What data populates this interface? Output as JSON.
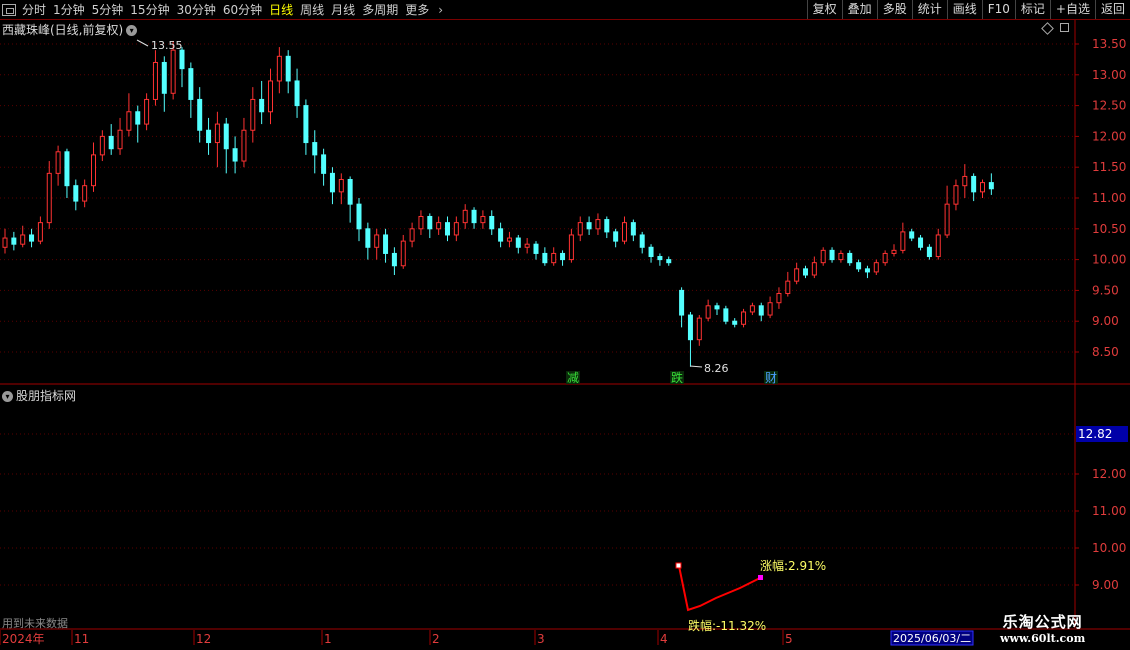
{
  "toolbar": {
    "periods": [
      "分时",
      "1分钟",
      "5分钟",
      "15分钟",
      "30分钟",
      "60分钟",
      "日线",
      "周线",
      "月线",
      "多周期",
      "更多"
    ],
    "active_period": "日线",
    "right_buttons": [
      "复权",
      "叠加",
      "多股",
      "统计",
      "画线",
      "F10",
      "标记",
      "+自选",
      "返回"
    ]
  },
  "main_chart": {
    "title": "西藏珠峰(日线,前复权)",
    "high_label": "13.55",
    "low_label": "8.26",
    "y_ticks": [
      "13.50",
      "13.00",
      "12.50",
      "12.00",
      "11.50",
      "11.00",
      "10.50",
      "10.00",
      "9.50",
      "9.00",
      "8.50"
    ],
    "markers": [
      {
        "text": "减",
        "color": "#38e038"
      },
      {
        "text": "跌",
        "color": "#38e038"
      },
      {
        "text": "财",
        "color": "#4aa0ff"
      }
    ]
  },
  "indicator": {
    "title": "股朋指标网",
    "current_value": "12.82",
    "y_ticks": [
      "12.00",
      "11.00",
      "10.00",
      "9.00"
    ],
    "rise_label": "涨幅:2.91%",
    "fall_label": "跌幅:-11.32%",
    "future_note": "用到未来数据"
  },
  "timeline": {
    "labels": [
      "2024年",
      "11",
      "12",
      "1",
      "2",
      "3",
      "4",
      "5"
    ],
    "current_date": "2025/06/03/二"
  },
  "watermark": {
    "line1": "乐淘公式网",
    "line2": "www.60lt.com"
  },
  "colors": {
    "up": "#ff3232",
    "down": "#54ffff",
    "grid": "#800000",
    "active": "#ffff00",
    "line": "#ff0000"
  },
  "icons": [
    "window-icon",
    "chevron-down-icon",
    "diamond-icon",
    "square-icon",
    "chevron-right-icon"
  ],
  "chart_data": {
    "type": "candlestick",
    "title": "西藏珠峰(日线,前复权)",
    "ylim": [
      8.0,
      13.8
    ],
    "x_ticks": [
      "2024年",
      "11",
      "12",
      "1",
      "2",
      "3",
      "4",
      "5"
    ],
    "candles": [
      [
        10.2,
        10.35,
        10.5,
        10.1
      ],
      [
        10.35,
        10.25,
        10.45,
        10.15
      ],
      [
        10.25,
        10.4,
        10.55,
        10.2
      ],
      [
        10.4,
        10.3,
        10.5,
        10.2
      ],
      [
        10.3,
        10.6,
        10.7,
        10.25
      ],
      [
        10.6,
        11.4,
        11.6,
        10.5
      ],
      [
        11.4,
        11.75,
        11.85,
        11.2
      ],
      [
        11.75,
        11.2,
        11.8,
        11.0
      ],
      [
        11.2,
        10.95,
        11.3,
        10.8
      ],
      [
        10.95,
        11.2,
        11.3,
        10.85
      ],
      [
        11.2,
        11.7,
        11.9,
        11.1
      ],
      [
        11.7,
        12.0,
        12.1,
        11.6
      ],
      [
        12.0,
        11.8,
        12.2,
        11.7
      ],
      [
        11.8,
        12.1,
        12.3,
        11.7
      ],
      [
        12.1,
        12.4,
        12.7,
        12.0
      ],
      [
        12.4,
        12.2,
        12.5,
        11.9
      ],
      [
        12.2,
        12.6,
        12.7,
        12.1
      ],
      [
        12.6,
        13.2,
        13.4,
        12.5
      ],
      [
        13.2,
        12.7,
        13.3,
        12.4
      ],
      [
        12.7,
        13.4,
        13.55,
        12.6
      ],
      [
        13.4,
        13.1,
        13.45,
        12.8
      ],
      [
        13.1,
        12.6,
        13.2,
        12.3
      ],
      [
        12.6,
        12.1,
        12.8,
        11.9
      ],
      [
        12.1,
        11.9,
        12.3,
        11.7
      ],
      [
        11.9,
        12.2,
        12.4,
        11.5
      ],
      [
        12.2,
        11.8,
        12.3,
        11.4
      ],
      [
        11.8,
        11.6,
        12.0,
        11.4
      ],
      [
        11.6,
        12.1,
        12.3,
        11.5
      ],
      [
        12.1,
        12.6,
        12.8,
        11.9
      ],
      [
        12.6,
        12.4,
        12.9,
        12.2
      ],
      [
        12.4,
        12.9,
        13.1,
        12.2
      ],
      [
        12.9,
        13.3,
        13.45,
        12.7
      ],
      [
        13.3,
        12.9,
        13.4,
        12.7
      ],
      [
        12.9,
        12.5,
        13.1,
        12.3
      ],
      [
        12.5,
        11.9,
        12.6,
        11.7
      ],
      [
        11.9,
        11.7,
        12.1,
        11.4
      ],
      [
        11.7,
        11.4,
        11.8,
        11.2
      ],
      [
        11.4,
        11.1,
        11.5,
        10.9
      ],
      [
        11.1,
        11.3,
        11.4,
        10.9
      ],
      [
        11.3,
        10.9,
        11.35,
        10.6
      ],
      [
        10.9,
        10.5,
        11.0,
        10.3
      ],
      [
        10.5,
        10.2,
        10.6,
        10.0
      ],
      [
        10.2,
        10.4,
        10.5,
        10.0
      ],
      [
        10.4,
        10.1,
        10.5,
        9.95
      ],
      [
        10.1,
        9.9,
        10.2,
        9.75
      ],
      [
        9.9,
        10.3,
        10.4,
        9.85
      ],
      [
        10.3,
        10.5,
        10.6,
        10.2
      ],
      [
        10.5,
        10.7,
        10.8,
        10.4
      ],
      [
        10.7,
        10.5,
        10.75,
        10.35
      ],
      [
        10.5,
        10.6,
        10.7,
        10.4
      ],
      [
        10.6,
        10.4,
        10.7,
        10.3
      ],
      [
        10.4,
        10.6,
        10.7,
        10.3
      ],
      [
        10.6,
        10.8,
        10.9,
        10.5
      ],
      [
        10.8,
        10.6,
        10.85,
        10.5
      ],
      [
        10.6,
        10.7,
        10.8,
        10.5
      ],
      [
        10.7,
        10.5,
        10.8,
        10.4
      ],
      [
        10.5,
        10.3,
        10.6,
        10.2
      ],
      [
        10.3,
        10.35,
        10.45,
        10.2
      ],
      [
        10.35,
        10.2,
        10.4,
        10.1
      ],
      [
        10.2,
        10.25,
        10.35,
        10.1
      ],
      [
        10.25,
        10.1,
        10.3,
        10.0
      ],
      [
        10.1,
        9.95,
        10.2,
        9.9
      ],
      [
        9.95,
        10.1,
        10.2,
        9.9
      ],
      [
        10.1,
        10.0,
        10.15,
        9.9
      ],
      [
        10.0,
        10.4,
        10.5,
        9.95
      ],
      [
        10.4,
        10.6,
        10.7,
        10.3
      ],
      [
        10.6,
        10.5,
        10.7,
        10.4
      ],
      [
        10.5,
        10.65,
        10.75,
        10.4
      ],
      [
        10.65,
        10.45,
        10.7,
        10.35
      ],
      [
        10.45,
        10.3,
        10.5,
        10.2
      ],
      [
        10.3,
        10.6,
        10.7,
        10.25
      ],
      [
        10.6,
        10.4,
        10.65,
        10.3
      ],
      [
        10.4,
        10.2,
        10.45,
        10.1
      ],
      [
        10.2,
        10.05,
        10.25,
        9.95
      ],
      [
        10.05,
        10.0,
        10.1,
        9.9
      ],
      [
        10.0,
        9.95,
        10.05,
        9.9
      ],
      [
        9.5,
        9.1,
        9.55,
        8.9
      ],
      [
        9.1,
        8.7,
        9.15,
        8.26
      ],
      [
        8.7,
        9.05,
        9.1,
        8.6
      ],
      [
        9.05,
        9.25,
        9.35,
        9.0
      ],
      [
        9.25,
        9.2,
        9.3,
        9.1
      ],
      [
        9.2,
        9.0,
        9.25,
        8.95
      ],
      [
        9.0,
        8.95,
        9.05,
        8.9
      ],
      [
        8.95,
        9.15,
        9.2,
        8.9
      ],
      [
        9.15,
        9.25,
        9.3,
        9.1
      ],
      [
        9.25,
        9.1,
        9.3,
        9.0
      ],
      [
        9.1,
        9.3,
        9.4,
        9.05
      ],
      [
        9.3,
        9.45,
        9.55,
        9.2
      ],
      [
        9.45,
        9.65,
        9.8,
        9.4
      ],
      [
        9.65,
        9.85,
        9.95,
        9.6
      ],
      [
        9.85,
        9.75,
        9.9,
        9.7
      ],
      [
        9.75,
        9.95,
        10.05,
        9.7
      ],
      [
        9.95,
        10.15,
        10.2,
        9.9
      ],
      [
        10.15,
        10.0,
        10.2,
        9.95
      ],
      [
        10.0,
        10.1,
        10.15,
        9.95
      ],
      [
        10.1,
        9.95,
        10.15,
        9.9
      ],
      [
        9.95,
        9.85,
        10.0,
        9.8
      ],
      [
        9.85,
        9.8,
        9.9,
        9.7
      ],
      [
        9.8,
        9.95,
        10.0,
        9.75
      ],
      [
        9.95,
        10.1,
        10.15,
        9.9
      ],
      [
        10.1,
        10.15,
        10.25,
        10.05
      ],
      [
        10.15,
        10.45,
        10.6,
        10.1
      ],
      [
        10.45,
        10.35,
        10.5,
        10.3
      ],
      [
        10.35,
        10.2,
        10.4,
        10.15
      ],
      [
        10.2,
        10.05,
        10.25,
        10.0
      ],
      [
        10.05,
        10.4,
        10.5,
        10.0
      ],
      [
        10.4,
        10.9,
        11.2,
        10.35
      ],
      [
        10.9,
        11.2,
        11.3,
        10.8
      ],
      [
        11.2,
        11.35,
        11.55,
        11.0
      ],
      [
        11.35,
        11.1,
        11.4,
        10.95
      ],
      [
        11.1,
        11.25,
        11.3,
        11.0
      ],
      [
        11.25,
        11.15,
        11.4,
        11.05
      ]
    ]
  }
}
